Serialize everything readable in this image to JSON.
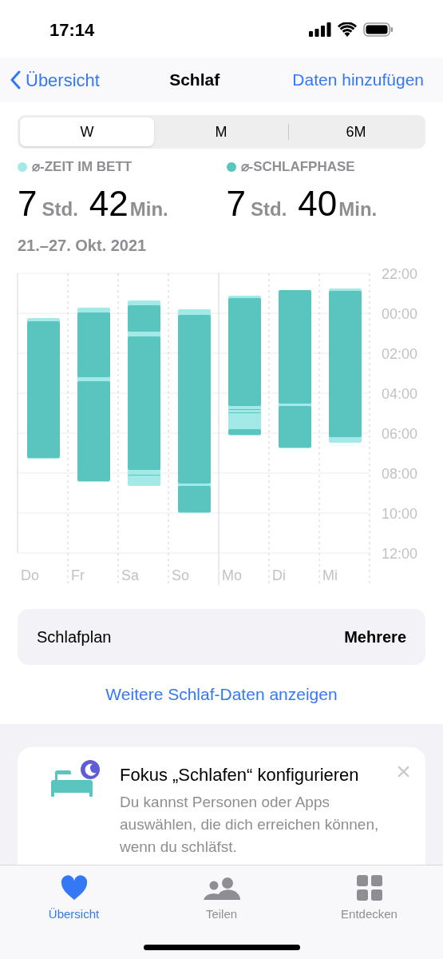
{
  "status_bar": {
    "time": "17:14"
  },
  "nav": {
    "back": "Übersicht",
    "title": "Schlaf",
    "action": "Daten hinzufügen"
  },
  "segments": [
    {
      "label": "W",
      "selected": true
    },
    {
      "label": "M",
      "selected": false
    },
    {
      "label": "6M",
      "selected": false
    }
  ],
  "stats": [
    {
      "label": "⌀-ZEIT IM BETT",
      "color": "#a3e9e8",
      "hours": "7",
      "hours_unit": "Std.",
      "minutes": "42",
      "minutes_unit": "Min."
    },
    {
      "label": "⌀-SCHLAFPHASE",
      "color": "#5ac4be",
      "hours": "7",
      "hours_unit": "Std.",
      "minutes": "40",
      "minutes_unit": "Min."
    }
  ],
  "date_range": "21.–27. Okt. 2021",
  "chart": {
    "day_labels": [
      "Do",
      "Fr",
      "Sa",
      "So",
      "Mo",
      "Di",
      "Mi"
    ],
    "time_labels": [
      "22:00",
      "00:00",
      "02:00",
      "04:00",
      "06:00",
      "08:00",
      "10:00",
      "12:00"
    ]
  },
  "schedule": {
    "label": "Schlafplan",
    "value": "Mehrere"
  },
  "more_link": "Weitere Schlaf-Daten anzeigen",
  "focus_card": {
    "title": "Fokus „Schlafen“ konfigurieren",
    "text": "Du kannst Personen oder Apps auswählen, die dich erreichen können, wenn du schläfst.",
    "close": "×"
  },
  "tab_bar": [
    {
      "kind": "heart",
      "label": "Übersicht",
      "selected": true
    },
    {
      "kind": "people",
      "label": "Teilen",
      "selected": false
    },
    {
      "kind": "grid",
      "label": "Entdecken",
      "selected": false
    }
  ]
}
